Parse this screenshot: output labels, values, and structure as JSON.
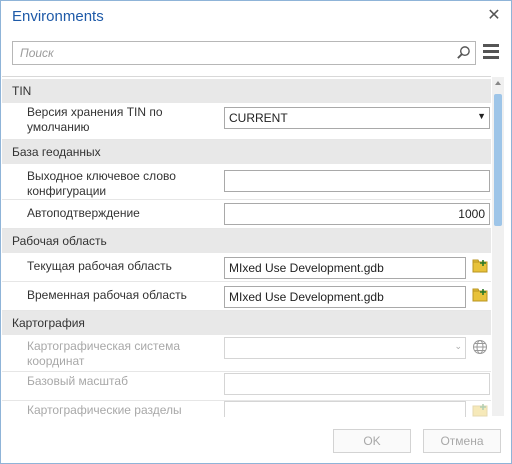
{
  "window": {
    "title": "Environments"
  },
  "search": {
    "placeholder": "Поиск"
  },
  "sections": [
    {
      "label": "TIN"
    },
    {
      "label": "База геоданных"
    },
    {
      "label": "Рабочая область"
    },
    {
      "label": "Картография"
    }
  ],
  "rows": {
    "tin_version": {
      "label": "Версия хранения TIN по умолчанию",
      "value": "CURRENT"
    },
    "output_keyword": {
      "label": "Выходное ключевое слово конфигурации",
      "value": ""
    },
    "autocommit": {
      "label": "Автоподтверждение",
      "value": "1000"
    },
    "current_workspace": {
      "label": "Текущая рабочая область",
      "value": "MIxed Use Development.gdb"
    },
    "scratch_workspace": {
      "label": "Временная рабочая область",
      "value": "MIxed Use Development.gdb"
    },
    "output_coord_system": {
      "label": "Картографическая система координат",
      "value": ""
    },
    "reference_scale": {
      "label": "Базовый масштаб",
      "value": ""
    },
    "cartographic_partitions": {
      "label": "Картографические разделы",
      "value": ""
    }
  },
  "buttons": {
    "ok": "OK",
    "cancel": "Отмена"
  },
  "colors": {
    "title": "#1e5aa8",
    "section_bg": "#e8e8e8",
    "scroll_thumb": "#9ec5e8",
    "folder": "#e8c23a"
  },
  "icons": [
    "close-icon",
    "search-icon",
    "menu-icon",
    "folder-icon",
    "globe-icon",
    "chevron-down-icon"
  ]
}
